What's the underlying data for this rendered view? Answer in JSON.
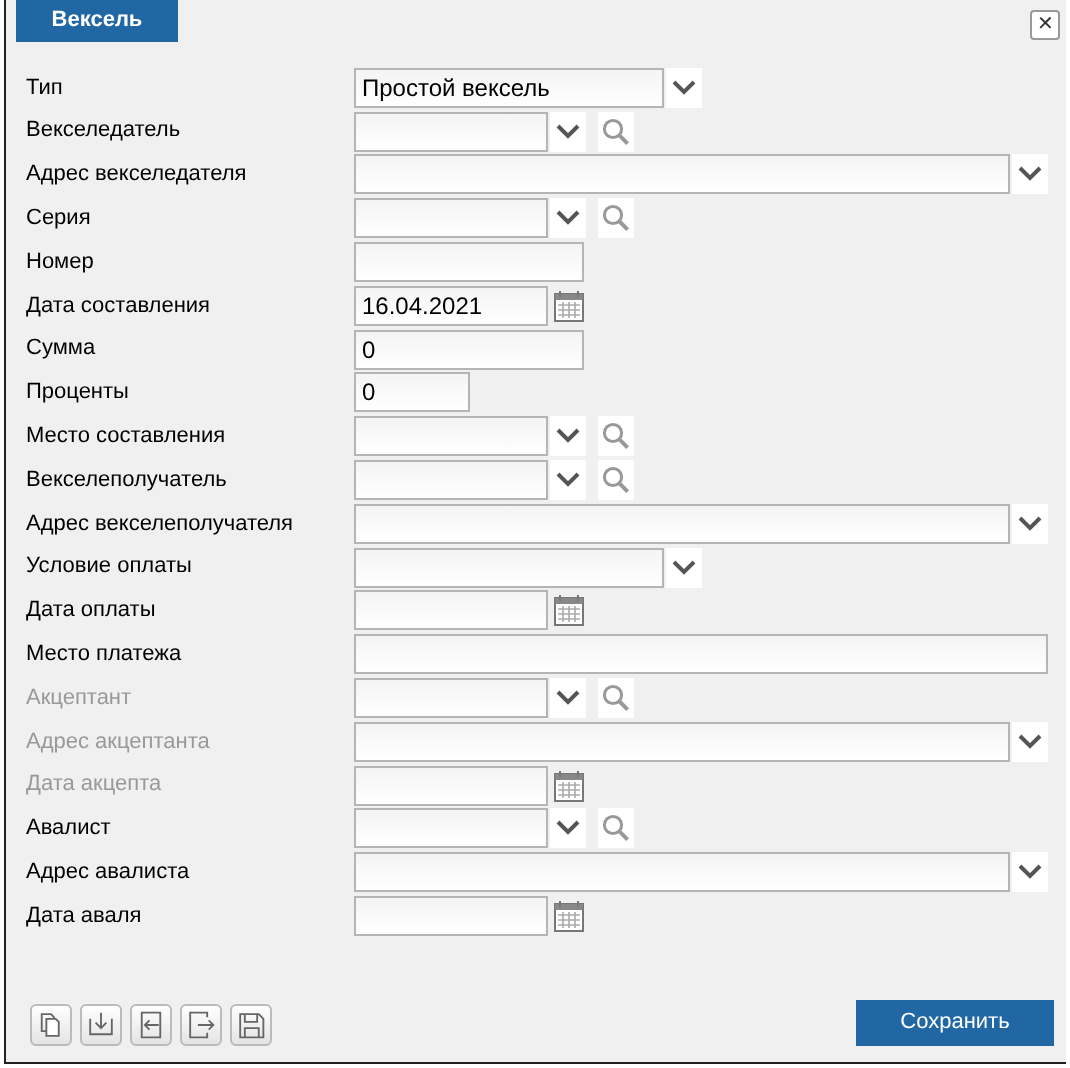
{
  "window": {
    "tab": "Вексель",
    "close": "✕"
  },
  "fields": [
    {
      "label": "Тип",
      "kind": "combo",
      "value": "Простой вексель",
      "disabled": false
    },
    {
      "label": "Векселедатель",
      "kind": "lookup",
      "disabled": false
    },
    {
      "label": "Адрес векселедателя",
      "kind": "address",
      "disabled": false
    },
    {
      "label": "Серия",
      "kind": "lookup",
      "disabled": false
    },
    {
      "label": "Номер",
      "kind": "text",
      "disabled": false
    },
    {
      "label": "Дата составления",
      "kind": "date",
      "value": "16.04.2021",
      "disabled": false
    },
    {
      "label": "Сумма",
      "kind": "text",
      "value": "0",
      "disabled": false
    },
    {
      "label": "Проценты",
      "kind": "short-text",
      "value": "0",
      "disabled": false
    },
    {
      "label": "Место составления",
      "kind": "lookup",
      "disabled": false
    },
    {
      "label": "Векселеполучатель",
      "kind": "lookup",
      "disabled": false
    },
    {
      "label": "Адрес векселеполучателя",
      "kind": "address",
      "disabled": false
    },
    {
      "label": "Условие оплаты",
      "kind": "combo",
      "disabled": false
    },
    {
      "label": "Дата оплаты",
      "kind": "date",
      "disabled": false
    },
    {
      "label": "Место платежа",
      "kind": "long-text",
      "disabled": false
    },
    {
      "label": "Акцептант",
      "kind": "lookup",
      "disabled": true
    },
    {
      "label": "Адрес акцептанта",
      "kind": "address",
      "disabled": true
    },
    {
      "label": "Дата акцепта",
      "kind": "date",
      "disabled": true
    },
    {
      "label": "Авалист",
      "kind": "lookup",
      "disabled": false
    },
    {
      "label": "Адрес авалиста",
      "kind": "address",
      "disabled": false
    },
    {
      "label": "Дата аваля",
      "kind": "date",
      "disabled": false
    }
  ],
  "toolbar": [
    {
      "kind": "copy"
    },
    {
      "kind": "import"
    },
    {
      "kind": "login"
    },
    {
      "kind": "logout"
    },
    {
      "kind": "save"
    }
  ],
  "save_button": "Сохранить"
}
